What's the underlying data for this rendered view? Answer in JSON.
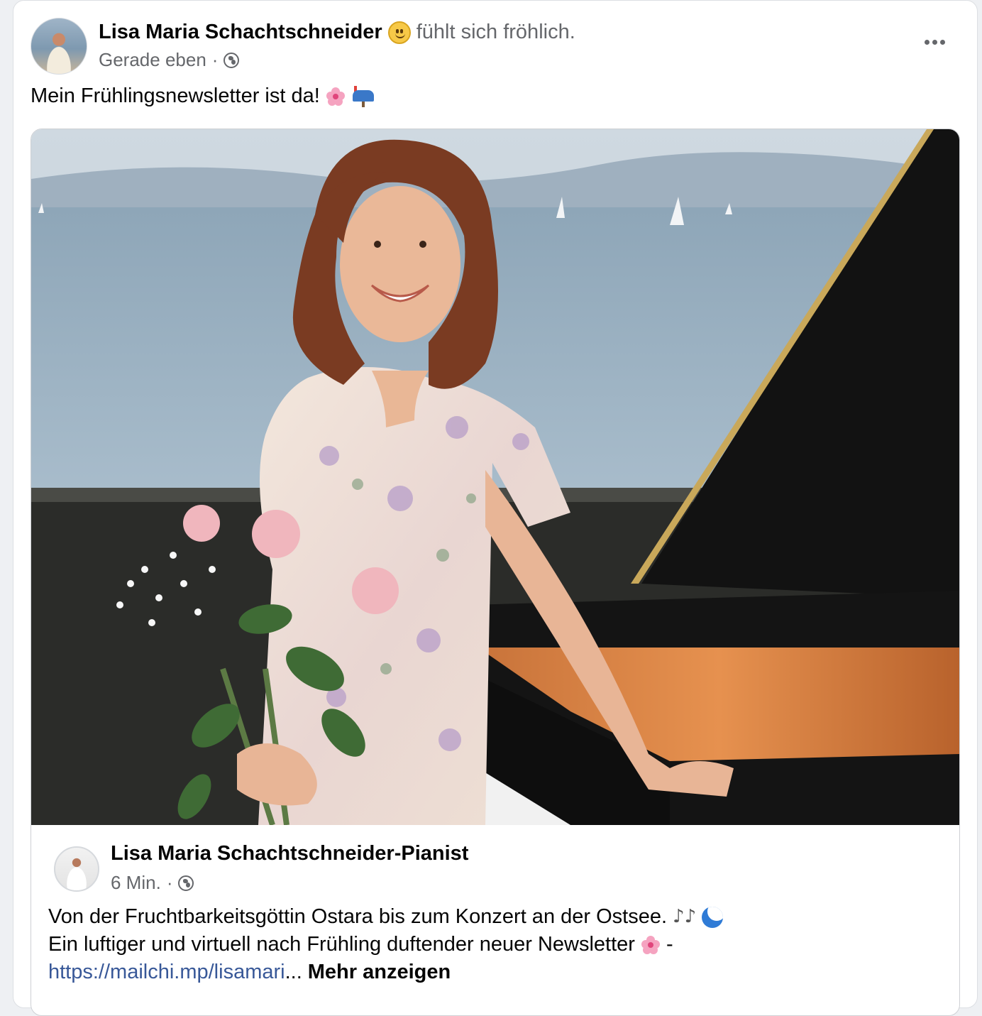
{
  "post": {
    "author": "Lisa Maria Schachtschneider",
    "feeling_emoji": "slightly-smiling-face-icon",
    "feeling_text": "fühlt sich fröhlich.",
    "timestamp": "Gerade eben",
    "separator": "·",
    "privacy_icon": "globe-icon",
    "more_icon": "more-options-icon",
    "text": "Mein Frühlingsnewsletter ist da!",
    "text_icons": [
      "cherry-blossom-icon",
      "mailbox-icon"
    ]
  },
  "shared": {
    "page_name": "Lisa Maria Schachtschneider-Pianist",
    "timestamp": "6 Min.",
    "separator": "·",
    "privacy_icon": "globe-icon",
    "line1": "Von der Fruchtbarkeitsgöttin Ostara bis zum Konzert an der Ostsee.",
    "line1_icons": [
      "musical-notes-icon",
      "wave-icon"
    ],
    "line2": "Ein luftiger und virtuell nach Frühling duftender neuer Newsletter",
    "line2_icon": "cherry-blossom-icon",
    "line2_suffix": "-",
    "link_text": "https://mailchi.mp/lisamari",
    "ellipsis": "...",
    "more_label": "Mehr anzeigen",
    "notes_glyph": "♪♪"
  },
  "colors": {
    "link": "#385898",
    "secondary_text": "#65676b",
    "primary_text": "#050505"
  }
}
